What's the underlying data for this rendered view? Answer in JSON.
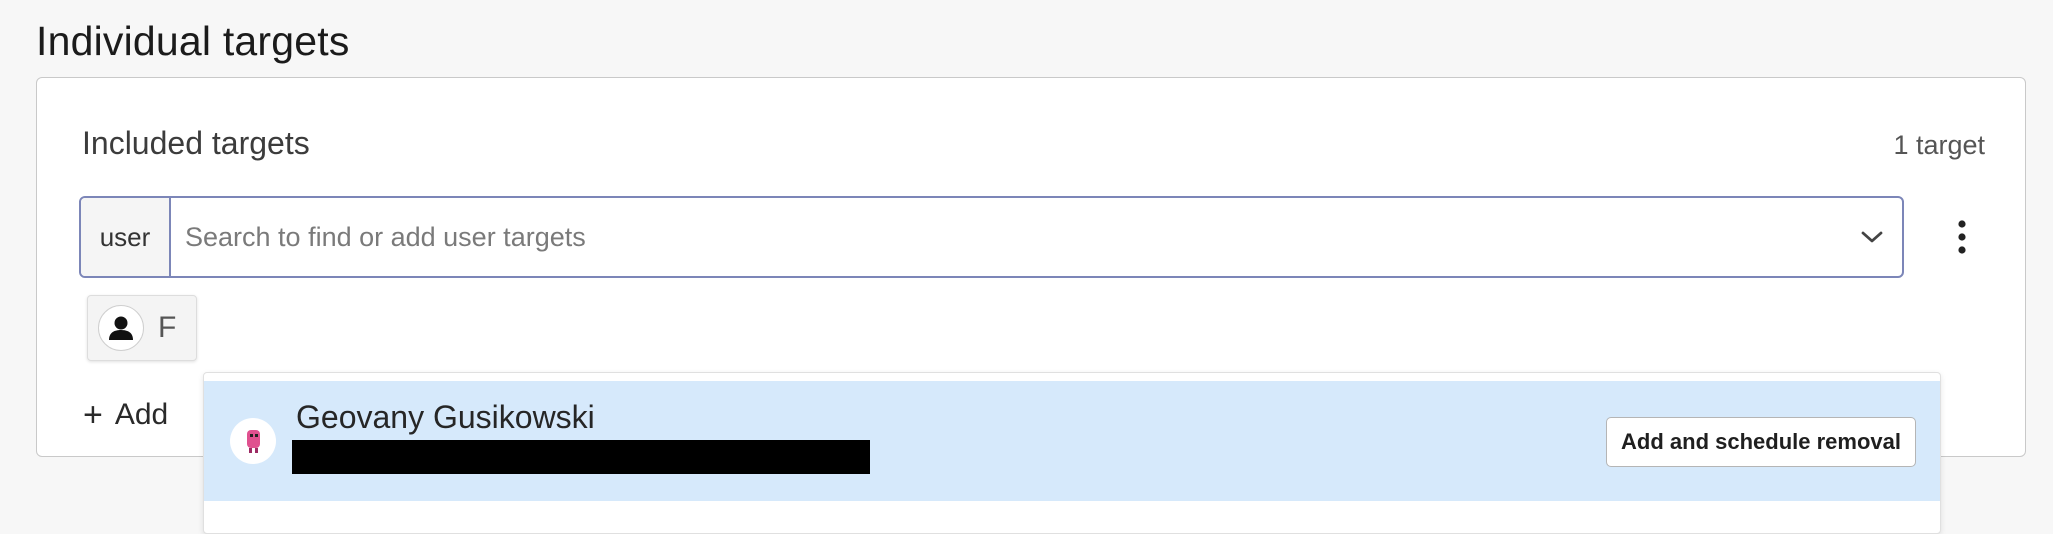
{
  "section": {
    "title": "Individual targets"
  },
  "card": {
    "subtitle": "Included targets",
    "count": "1 target"
  },
  "search": {
    "kind": "user",
    "placeholder": "Search to find or add user targets",
    "value": ""
  },
  "selected_chip": {
    "text": "F",
    "icon": "person-icon"
  },
  "add_link": {
    "label": "Add"
  },
  "dropdown": {
    "option": {
      "name": "Geovany Gusikowski",
      "avatar": "pink-character-avatar",
      "action_label": "Add and schedule removal"
    }
  },
  "colors": {
    "highlight": "#d6e9fb",
    "focus_border": "#7c86b8"
  }
}
